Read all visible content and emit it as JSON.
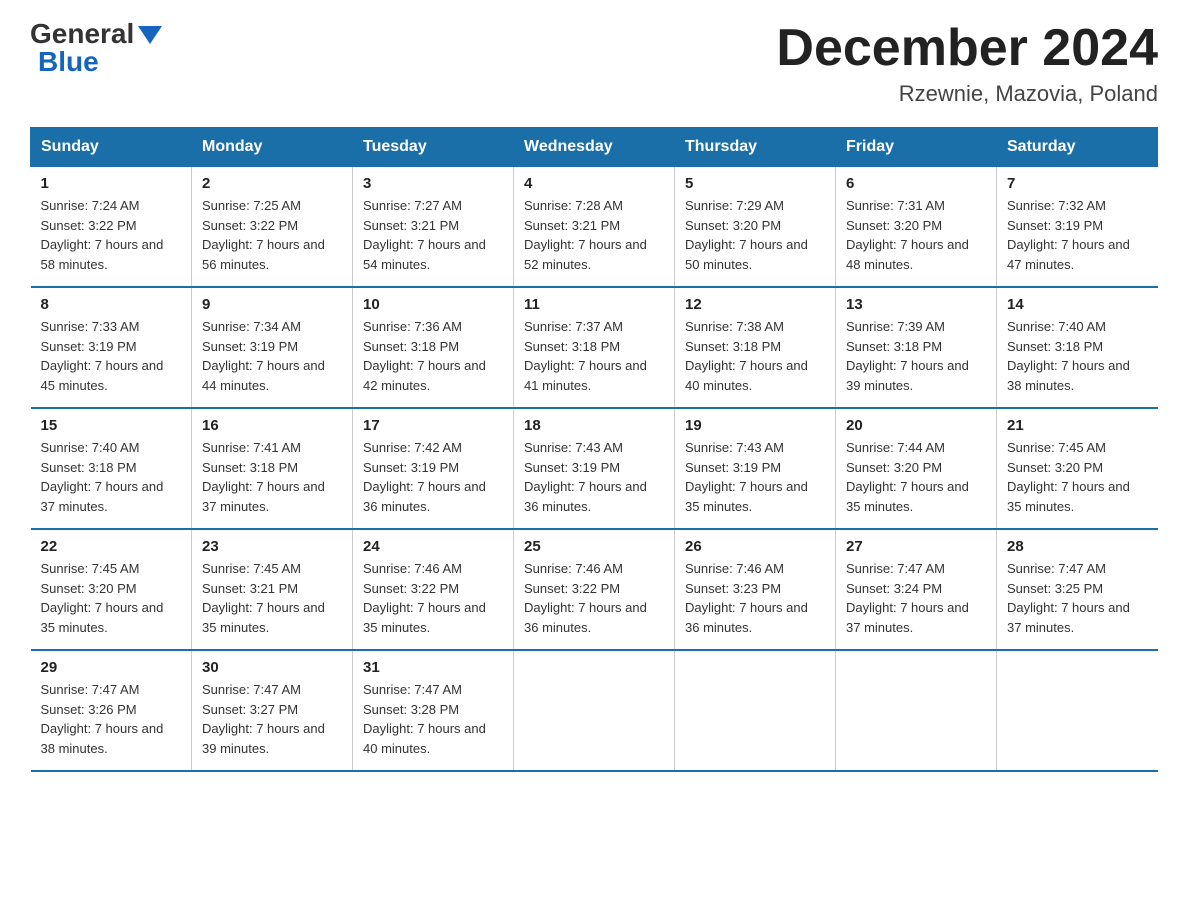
{
  "header": {
    "logo_general": "General",
    "logo_blue": "Blue",
    "month_title": "December 2024",
    "location": "Rzewnie, Mazovia, Poland"
  },
  "weekdays": [
    "Sunday",
    "Monday",
    "Tuesday",
    "Wednesday",
    "Thursday",
    "Friday",
    "Saturday"
  ],
  "weeks": [
    [
      {
        "day": "1",
        "sunrise": "7:24 AM",
        "sunset": "3:22 PM",
        "daylight": "7 hours and 58 minutes."
      },
      {
        "day": "2",
        "sunrise": "7:25 AM",
        "sunset": "3:22 PM",
        "daylight": "7 hours and 56 minutes."
      },
      {
        "day": "3",
        "sunrise": "7:27 AM",
        "sunset": "3:21 PM",
        "daylight": "7 hours and 54 minutes."
      },
      {
        "day": "4",
        "sunrise": "7:28 AM",
        "sunset": "3:21 PM",
        "daylight": "7 hours and 52 minutes."
      },
      {
        "day": "5",
        "sunrise": "7:29 AM",
        "sunset": "3:20 PM",
        "daylight": "7 hours and 50 minutes."
      },
      {
        "day": "6",
        "sunrise": "7:31 AM",
        "sunset": "3:20 PM",
        "daylight": "7 hours and 48 minutes."
      },
      {
        "day": "7",
        "sunrise": "7:32 AM",
        "sunset": "3:19 PM",
        "daylight": "7 hours and 47 minutes."
      }
    ],
    [
      {
        "day": "8",
        "sunrise": "7:33 AM",
        "sunset": "3:19 PM",
        "daylight": "7 hours and 45 minutes."
      },
      {
        "day": "9",
        "sunrise": "7:34 AM",
        "sunset": "3:19 PM",
        "daylight": "7 hours and 44 minutes."
      },
      {
        "day": "10",
        "sunrise": "7:36 AM",
        "sunset": "3:18 PM",
        "daylight": "7 hours and 42 minutes."
      },
      {
        "day": "11",
        "sunrise": "7:37 AM",
        "sunset": "3:18 PM",
        "daylight": "7 hours and 41 minutes."
      },
      {
        "day": "12",
        "sunrise": "7:38 AM",
        "sunset": "3:18 PM",
        "daylight": "7 hours and 40 minutes."
      },
      {
        "day": "13",
        "sunrise": "7:39 AM",
        "sunset": "3:18 PM",
        "daylight": "7 hours and 39 minutes."
      },
      {
        "day": "14",
        "sunrise": "7:40 AM",
        "sunset": "3:18 PM",
        "daylight": "7 hours and 38 minutes."
      }
    ],
    [
      {
        "day": "15",
        "sunrise": "7:40 AM",
        "sunset": "3:18 PM",
        "daylight": "7 hours and 37 minutes."
      },
      {
        "day": "16",
        "sunrise": "7:41 AM",
        "sunset": "3:18 PM",
        "daylight": "7 hours and 37 minutes."
      },
      {
        "day": "17",
        "sunrise": "7:42 AM",
        "sunset": "3:19 PM",
        "daylight": "7 hours and 36 minutes."
      },
      {
        "day": "18",
        "sunrise": "7:43 AM",
        "sunset": "3:19 PM",
        "daylight": "7 hours and 36 minutes."
      },
      {
        "day": "19",
        "sunrise": "7:43 AM",
        "sunset": "3:19 PM",
        "daylight": "7 hours and 35 minutes."
      },
      {
        "day": "20",
        "sunrise": "7:44 AM",
        "sunset": "3:20 PM",
        "daylight": "7 hours and 35 minutes."
      },
      {
        "day": "21",
        "sunrise": "7:45 AM",
        "sunset": "3:20 PM",
        "daylight": "7 hours and 35 minutes."
      }
    ],
    [
      {
        "day": "22",
        "sunrise": "7:45 AM",
        "sunset": "3:20 PM",
        "daylight": "7 hours and 35 minutes."
      },
      {
        "day": "23",
        "sunrise": "7:45 AM",
        "sunset": "3:21 PM",
        "daylight": "7 hours and 35 minutes."
      },
      {
        "day": "24",
        "sunrise": "7:46 AM",
        "sunset": "3:22 PM",
        "daylight": "7 hours and 35 minutes."
      },
      {
        "day": "25",
        "sunrise": "7:46 AM",
        "sunset": "3:22 PM",
        "daylight": "7 hours and 36 minutes."
      },
      {
        "day": "26",
        "sunrise": "7:46 AM",
        "sunset": "3:23 PM",
        "daylight": "7 hours and 36 minutes."
      },
      {
        "day": "27",
        "sunrise": "7:47 AM",
        "sunset": "3:24 PM",
        "daylight": "7 hours and 37 minutes."
      },
      {
        "day": "28",
        "sunrise": "7:47 AM",
        "sunset": "3:25 PM",
        "daylight": "7 hours and 37 minutes."
      }
    ],
    [
      {
        "day": "29",
        "sunrise": "7:47 AM",
        "sunset": "3:26 PM",
        "daylight": "7 hours and 38 minutes."
      },
      {
        "day": "30",
        "sunrise": "7:47 AM",
        "sunset": "3:27 PM",
        "daylight": "7 hours and 39 minutes."
      },
      {
        "day": "31",
        "sunrise": "7:47 AM",
        "sunset": "3:28 PM",
        "daylight": "7 hours and 40 minutes."
      },
      null,
      null,
      null,
      null
    ]
  ]
}
